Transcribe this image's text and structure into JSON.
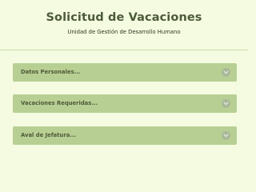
{
  "header": {
    "title": "Solicitud de Vacaciones",
    "subtitle": "Unidad de Gestión de Desarrollo Humano"
  },
  "sections": [
    {
      "label": "Datos Personales...",
      "icon": "chevron-down-icon"
    },
    {
      "label": "Vacaciones Requeridas...",
      "icon": "chevron-down-icon"
    },
    {
      "label": "Aval de Jefatura...",
      "icon": "chevron-down-icon"
    }
  ],
  "colors": {
    "background": "#f4fbe0",
    "section_bar": "#b8cf94",
    "title_text": "#4e5b3a"
  }
}
